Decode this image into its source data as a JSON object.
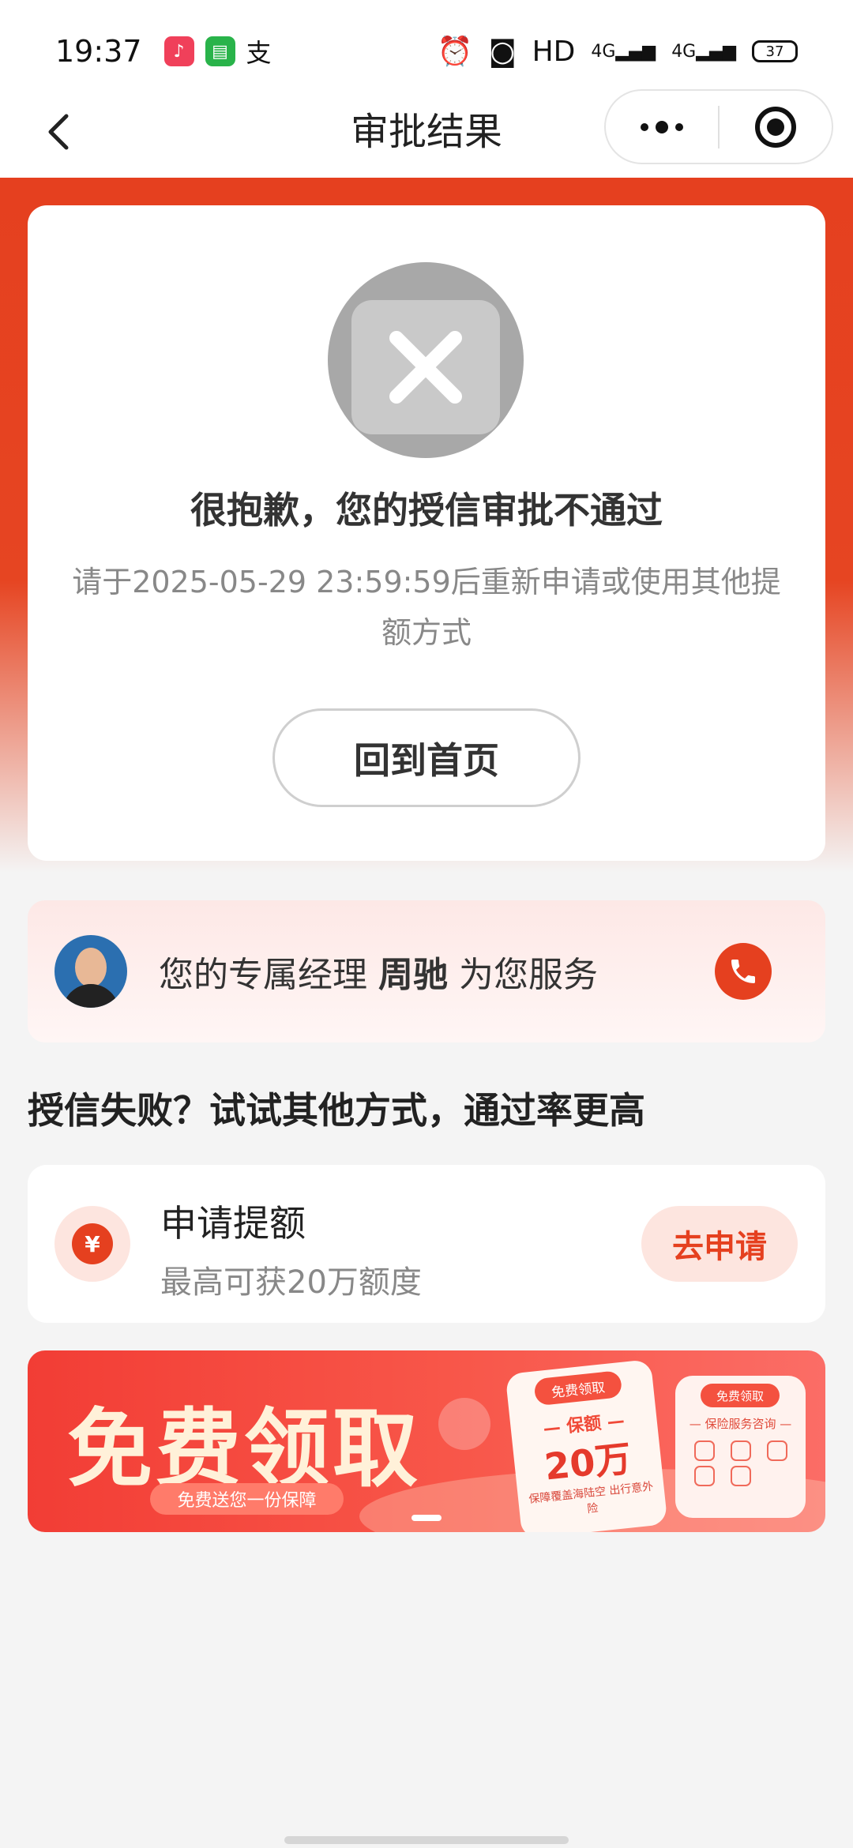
{
  "status_bar": {
    "time": "19:37",
    "network": "HD",
    "signal1": "4G",
    "signal2": "4G",
    "battery": "37"
  },
  "nav": {
    "title": "审批结果"
  },
  "result": {
    "title": "很抱歉，您的授信审批不通过",
    "desc": "请于2025-05-29 23:59:59后重新申请或使用其他提额方式",
    "home_button": "回到首页"
  },
  "manager": {
    "prefix": "您的专属经理",
    "name": "周驰",
    "suffix": "为您服务"
  },
  "section_heading": "授信失败？试试其他方式，通过率更高",
  "quota": {
    "icon_glyph": "¥",
    "title": "申请提额",
    "subtitle": "最高可获20万额度",
    "apply_button": "去申请"
  },
  "banner": {
    "title": "免费领取",
    "pill": "免费送您一份保障",
    "card1_tag": "免费领取",
    "card1_label": "— 保额 —",
    "card1_amount": "20万",
    "card1_note": "保障覆盖海陆空 出行意外险",
    "card2_tag": "免费领取",
    "card2_label": "— 保险服务咨询 —"
  },
  "colors": {
    "brand_red": "#e5401f",
    "apply_bg": "#fde5df"
  }
}
